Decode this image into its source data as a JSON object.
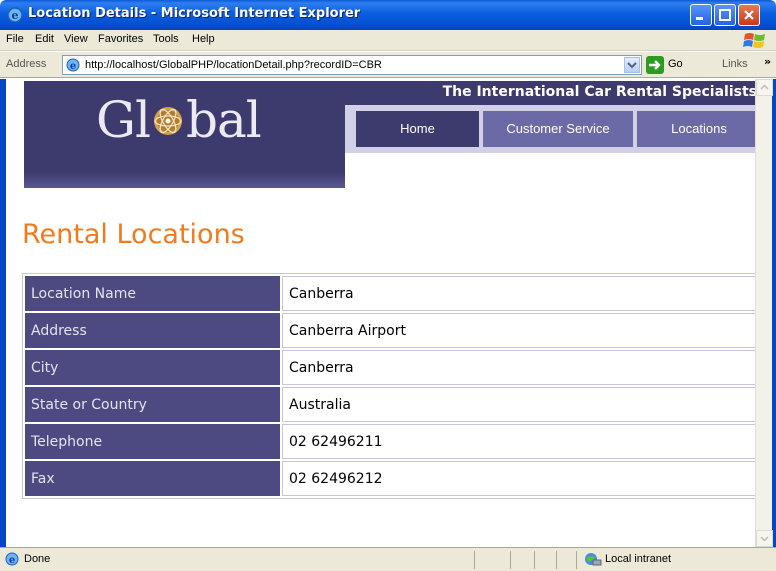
{
  "window": {
    "title": "Location Details - Microsoft Internet Explorer"
  },
  "menu": {
    "items": [
      "File",
      "Edit",
      "View",
      "Favorites",
      "Tools",
      "Help"
    ]
  },
  "address_bar": {
    "label": "Address",
    "url": "http://localhost/GlobalPHP/locationDetail.php?recordID=CBR",
    "go_label": "Go",
    "links_label": "Links"
  },
  "site": {
    "logo_left": "Gl",
    "logo_right": "bal",
    "tagline": "The International Car Rental Specialists",
    "nav": [
      {
        "label": "Home",
        "active": true
      },
      {
        "label": "Customer Service",
        "active": false
      },
      {
        "label": "Locations",
        "active": false
      }
    ]
  },
  "main": {
    "title": "Rental Locations",
    "details": [
      {
        "label": "Location Name",
        "value": "Canberra"
      },
      {
        "label": "Address",
        "value": "Canberra Airport"
      },
      {
        "label": "City",
        "value": "Canberra"
      },
      {
        "label": "State or Country",
        "value": "Australia"
      },
      {
        "label": "Telephone",
        "value": "02 62496211"
      },
      {
        "label": "Fax",
        "value": "02 62496212"
      }
    ]
  },
  "status": {
    "text": "Done",
    "zone": "Local intranet"
  },
  "colors": {
    "brand_purple": "#3d3a6e",
    "title_orange": "#f07b1e",
    "xp_blue": "#0447c7"
  }
}
